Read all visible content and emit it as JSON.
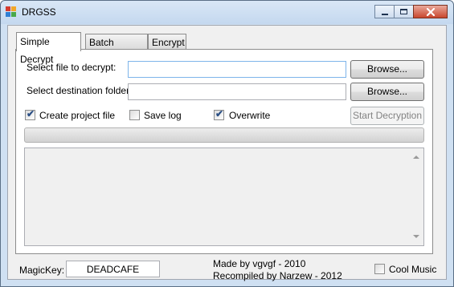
{
  "window": {
    "title": "DRGSS"
  },
  "tabs": [
    {
      "label": "Simple Decrypt"
    },
    {
      "label": "Batch Decrypt"
    },
    {
      "label": "Encrypt"
    }
  ],
  "form": {
    "source_label": "Select file to decrypt:",
    "source_value": "",
    "dest_label": "Select destination folder:",
    "dest_value": "",
    "browse_label": "Browse...",
    "browse2_label": "Browse..."
  },
  "options": {
    "create_project_label": "Create project file",
    "create_project_checked": true,
    "save_log_label": "Save log",
    "save_log_checked": false,
    "overwrite_label": "Overwrite",
    "overwrite_checked": true,
    "start_label": "Start Decryption"
  },
  "progress": {
    "value": 0
  },
  "footer": {
    "magickey_label": "MagicKey:",
    "magickey_value": "DEADCAFE",
    "credit_line1": "Made by vgvgf - 2010",
    "credit_line2": "Recompiled by Narzew - 2012",
    "cool_music_label": "Cool Music",
    "cool_music_checked": false
  },
  "icons": [
    "app-icon",
    "minimize-icon",
    "maximize-icon",
    "close-icon",
    "checkmark-icon",
    "scroll-up-icon",
    "scroll-down-icon"
  ]
}
